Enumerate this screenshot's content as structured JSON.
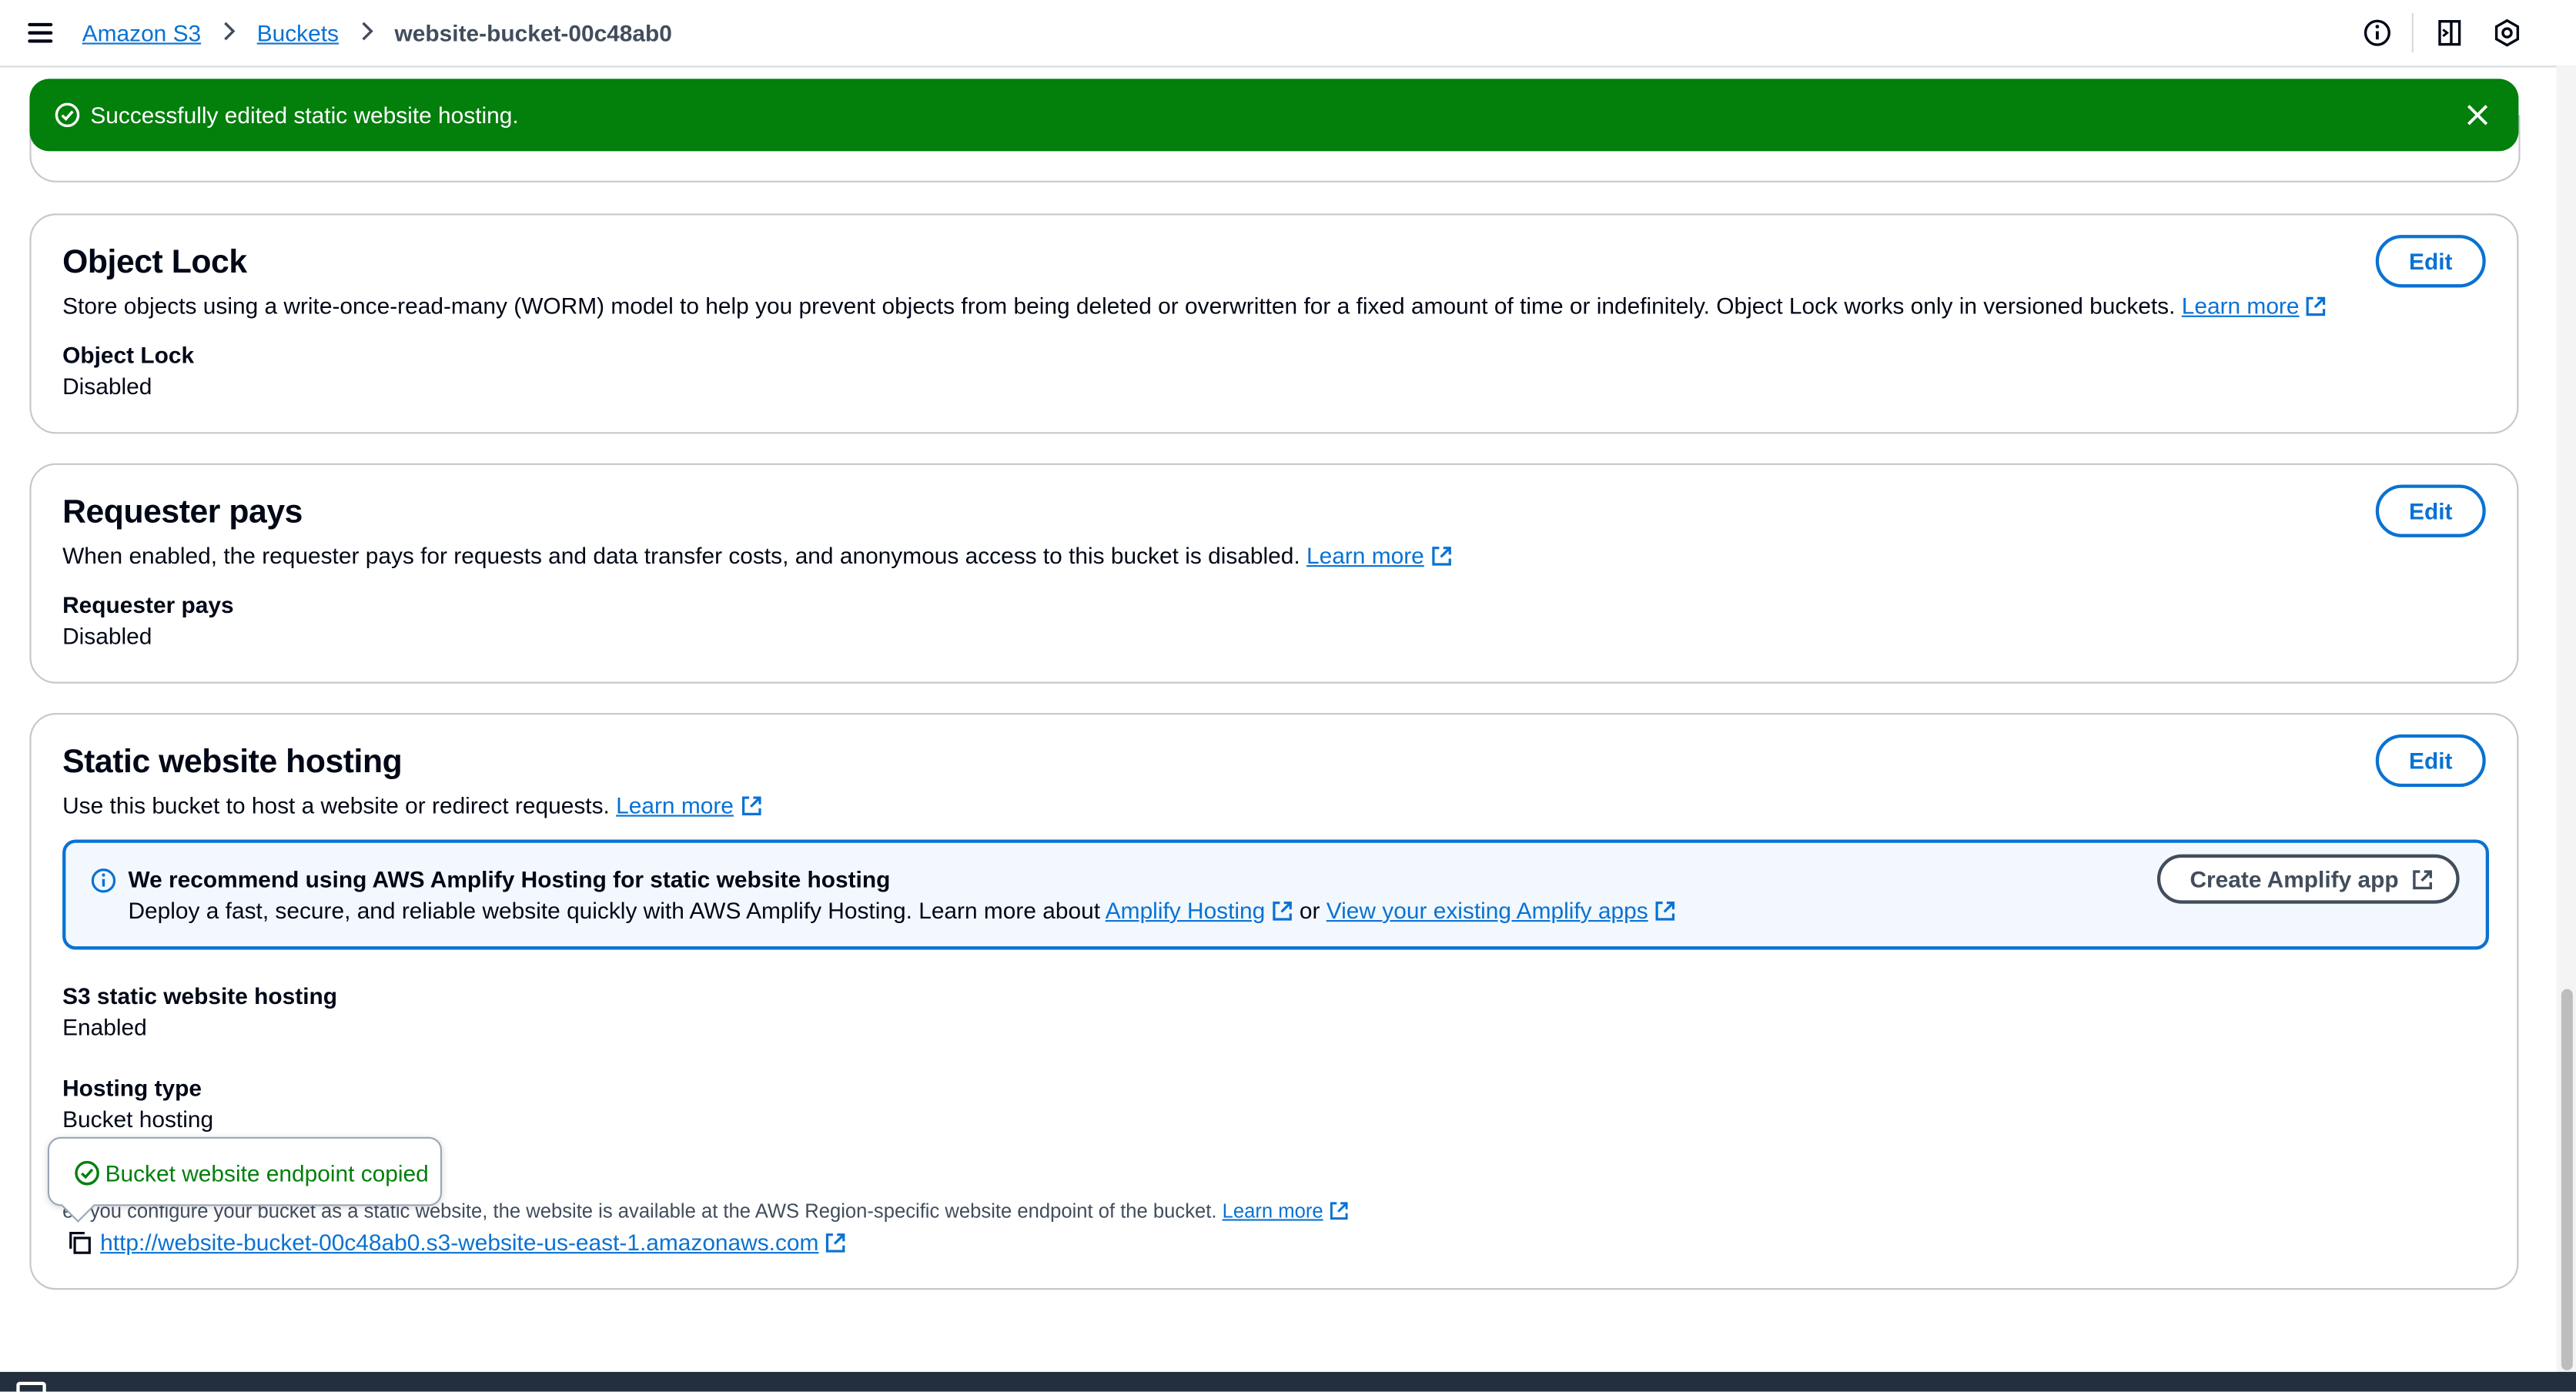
{
  "breadcrumb": {
    "items": [
      "Amazon S3",
      "Buckets"
    ],
    "current": "website-bucket-00c48ab0"
  },
  "flash": {
    "message": "Successfully edited static website hosting.",
    "color": "#037f0c"
  },
  "object_lock": {
    "title": "Object Lock",
    "description": "Store objects using a write-once-read-many (WORM) model to help you prevent objects from being deleted or overwritten for a fixed amount of time or indefinitely. Object Lock works only in versioned buckets.",
    "learn_more": "Learn more",
    "edit_label": "Edit",
    "field_label": "Object Lock",
    "field_value": "Disabled"
  },
  "requester_pays": {
    "title": "Requester pays",
    "description": "When enabled, the requester pays for requests and data transfer costs, and anonymous access to this bucket is disabled.",
    "learn_more": "Learn more",
    "edit_label": "Edit",
    "field_label": "Requester pays",
    "field_value": "Disabled"
  },
  "static_hosting": {
    "title": "Static website hosting",
    "description": "Use this bucket to host a website or redirect requests.",
    "learn_more": "Learn more",
    "edit_label": "Edit",
    "info": {
      "heading": "We recommend using AWS Amplify Hosting for static website hosting",
      "body": "Deploy a fast, secure, and reliable website quickly with AWS Amplify Hosting. Learn more about",
      "link1": "Amplify Hosting",
      "or": "or",
      "link2": "View your existing Amplify apps",
      "button": "Create Amplify app"
    },
    "hosting_label": "S3 static website hosting",
    "hosting_value": "Enabled",
    "type_label": "Hosting type",
    "type_value": "Bucket hosting",
    "endpoint_desc": "en you configure your bucket as a static website, the website is available at the AWS Region-specific website endpoint of the bucket.",
    "endpoint_learn_more": "Learn more",
    "endpoint_url": "http://website-bucket-00c48ab0.s3-website-us-east-1.amazonaws.com"
  },
  "popover": {
    "message": "Bucket website endpoint copied"
  },
  "colors": {
    "link": "#0972d3",
    "success": "#037f0c",
    "text": "#000716",
    "info_bg": "#f2f8fd",
    "footer": "#232f3e"
  }
}
